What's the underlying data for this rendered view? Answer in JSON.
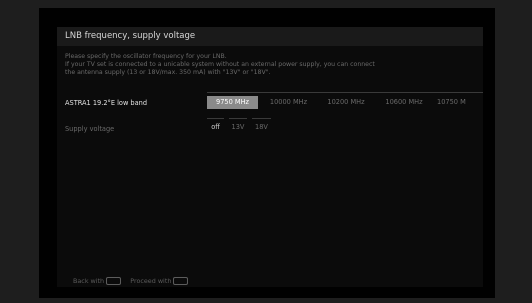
{
  "title": "LNB frequency, supply voltage",
  "description": [
    "Please specify the oscillator frequency for your LNB.",
    "If your TV set is connected to a unicable system without an external power supply, you can connect",
    "the antenna supply (13 or 18V/max. 350 mA) with \"13V\" or \"18V\"."
  ],
  "lnb_row": {
    "label": "ASTRA1 19.2°E low band",
    "options": [
      "9750 MHz",
      "10000 MHz",
      "10200 MHz",
      "10600 MHz",
      "10750 M"
    ],
    "selected": "9750 MHz"
  },
  "voltage_row": {
    "label": "Supply voltage",
    "options": [
      "off",
      "13V",
      "18V"
    ],
    "selected": "off"
  },
  "footer": {
    "back_label": "Back with",
    "proceed_label": "Proceed with",
    "key_icon": "remote-key-icon"
  },
  "colors": {
    "background": "#1e1e1e",
    "panel": "#0b0b0b",
    "header": "#1a1a1a",
    "selected": "#8a8a8a"
  }
}
